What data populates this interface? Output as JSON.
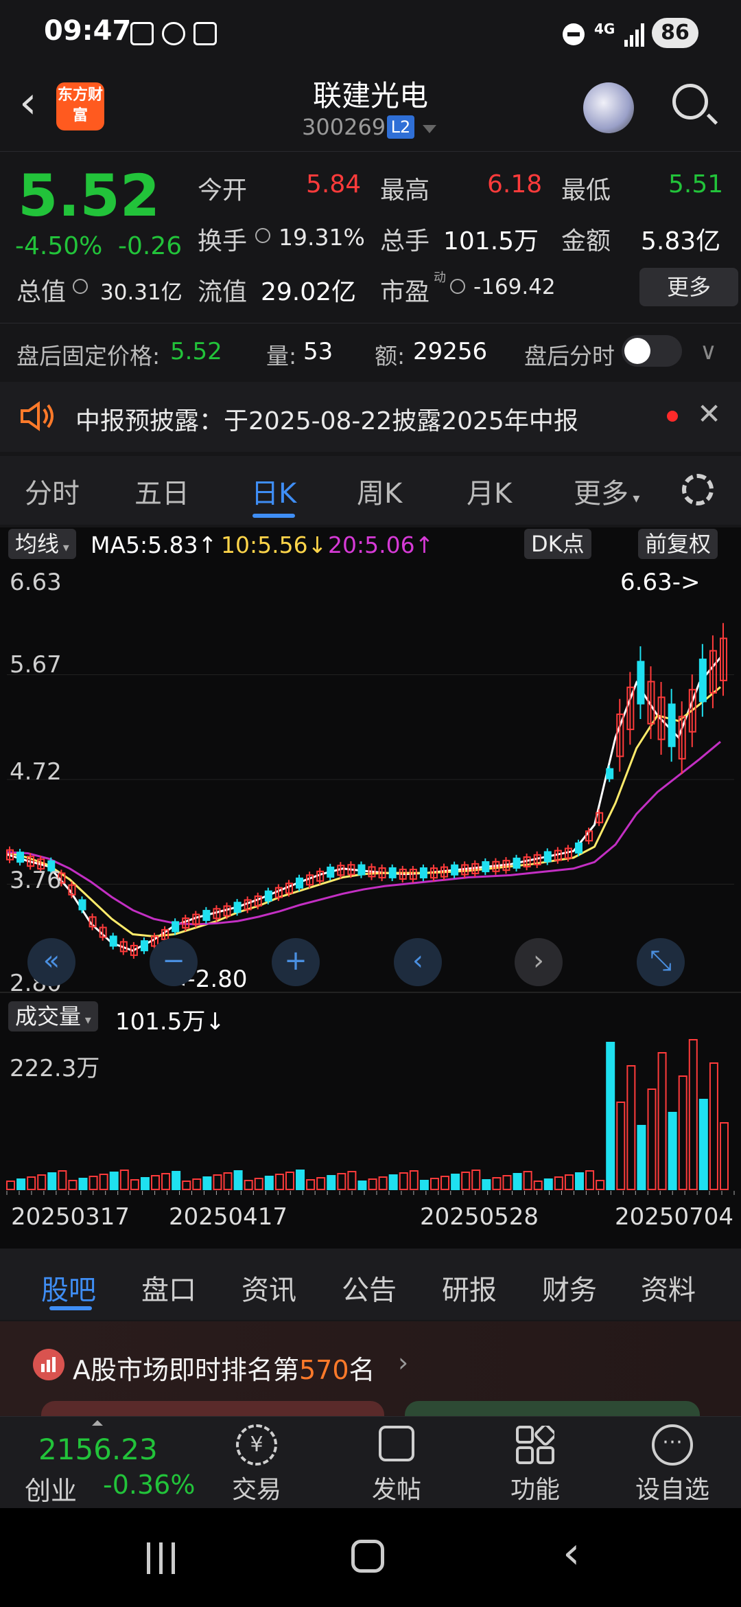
{
  "status_bar": {
    "time": "09:47",
    "network": "4G",
    "battery": "86"
  },
  "header": {
    "logo_text": "东方财富",
    "stock_name": "联建光电",
    "stock_code": "300269",
    "level_badge": "L2"
  },
  "quote": {
    "price": "5.52",
    "change_pct": "-4.50%",
    "change_abs": "-0.26",
    "open_label": "今开",
    "open": "5.84",
    "high_label": "最高",
    "high": "6.18",
    "low_label": "最低",
    "low": "5.51",
    "turnover_label": "换手",
    "turnover": "19.31%",
    "volume_label": "总手",
    "volume": "101.5万",
    "amount_label": "金额",
    "amount": "5.83亿",
    "total_cap_label": "总值",
    "total_cap": "30.31亿",
    "float_cap_label": "流值",
    "float_cap": "29.02亿",
    "pe_label": "市盈",
    "pe_sup": "动",
    "pe": "-169.42",
    "more_button": "更多"
  },
  "after_hours": {
    "price_label": "盘后固定价格:",
    "price": "5.52",
    "vol_label": "量:",
    "vol": "53",
    "amt_label": "额:",
    "amt": "29256",
    "timeshare_label": "盘后分时"
  },
  "notice": {
    "text": "中报预披露：于2025-08-22披露2025年中报"
  },
  "kline_tabs": [
    {
      "label": "分时"
    },
    {
      "label": "五日"
    },
    {
      "label": "日K"
    },
    {
      "label": "周K"
    },
    {
      "label": "月K"
    },
    {
      "label": "更多"
    }
  ],
  "chart": {
    "ma_chip": "均线",
    "ma5": "MA5:5.83",
    "ma10": "10:5.56",
    "ma20": "20:5.06",
    "dk_chip": "DK点",
    "adjust_chip": "前复权",
    "y_ticks": [
      "6.63",
      "5.67",
      "4.72",
      "3.76",
      "2.80"
    ],
    "max_marker": "6.63->",
    "min_marker": "<-2.80",
    "volume_chip": "成交量",
    "volume_value": "101.5万",
    "volume_max": "222.3万",
    "x_labels": [
      "20250317",
      "20250417",
      "20250528",
      "20250704"
    ],
    "colors": {
      "up": "#ff3b3b",
      "down": "#1fe0f0",
      "ma5": "#ffffff",
      "ma10": "#ffeb6b",
      "ma20": "#c32fc3"
    }
  },
  "chart_data": {
    "type": "candlestick",
    "series": [
      {
        "name": "MA5",
        "values": [
          4.03,
          3.97,
          3.92,
          3.7,
          3.4,
          3.22,
          3.15,
          3.25,
          3.38,
          3.45,
          3.5,
          3.55,
          3.62,
          3.7,
          3.78,
          3.85,
          3.9,
          3.88,
          3.86,
          3.85,
          3.86,
          3.88,
          3.9,
          3.92,
          3.94,
          3.98,
          4.02,
          4.06,
          4.3,
          5.1,
          5.6,
          5.3,
          5.1,
          5.6,
          5.83
        ]
      },
      {
        "name": "10",
        "values": [
          4.05,
          4.0,
          3.93,
          3.8,
          3.62,
          3.44,
          3.3,
          3.28,
          3.3,
          3.36,
          3.42,
          3.5,
          3.56,
          3.64,
          3.7,
          3.76,
          3.82,
          3.85,
          3.86,
          3.86,
          3.86,
          3.87,
          3.88,
          3.9,
          3.92,
          3.94,
          3.97,
          4.0,
          4.1,
          4.5,
          5.0,
          5.3,
          5.25,
          5.4,
          5.56
        ]
      },
      {
        "name": "20",
        "values": [
          4.05,
          4.04,
          3.99,
          3.9,
          3.78,
          3.64,
          3.52,
          3.44,
          3.4,
          3.39,
          3.4,
          3.42,
          3.46,
          3.51,
          3.57,
          3.62,
          3.67,
          3.71,
          3.74,
          3.76,
          3.78,
          3.8,
          3.82,
          3.83,
          3.84,
          3.86,
          3.88,
          3.9,
          3.96,
          4.12,
          4.4,
          4.6,
          4.75,
          4.9,
          5.06
        ]
      }
    ],
    "y_range": [
      2.8,
      6.63
    ],
    "x_labels": [
      "20250317",
      "20250417",
      "20250528",
      "20250704"
    ],
    "latest_ma": {
      "MA5": 5.83,
      "10": 5.56,
      "20": 5.06
    },
    "volume_max": "222.3万"
  },
  "chart_controls": [
    "double-left",
    "minus",
    "plus",
    "left",
    "right",
    "expand"
  ],
  "bottom_tabs": [
    {
      "label": "股吧"
    },
    {
      "label": "盘口"
    },
    {
      "label": "资讯"
    },
    {
      "label": "公告"
    },
    {
      "label": "研报"
    },
    {
      "label": "财务"
    },
    {
      "label": "资料"
    }
  ],
  "rank": {
    "prefix": "A股市场即时排名第",
    "number": "570",
    "suffix": "名"
  },
  "bottom_bar": {
    "index_value": "2156.23",
    "index_name": "创业",
    "index_change": "-0.36%",
    "items": [
      {
        "label": "交易"
      },
      {
        "label": "发帖"
      },
      {
        "label": "功能"
      },
      {
        "label": "设自选"
      }
    ]
  }
}
